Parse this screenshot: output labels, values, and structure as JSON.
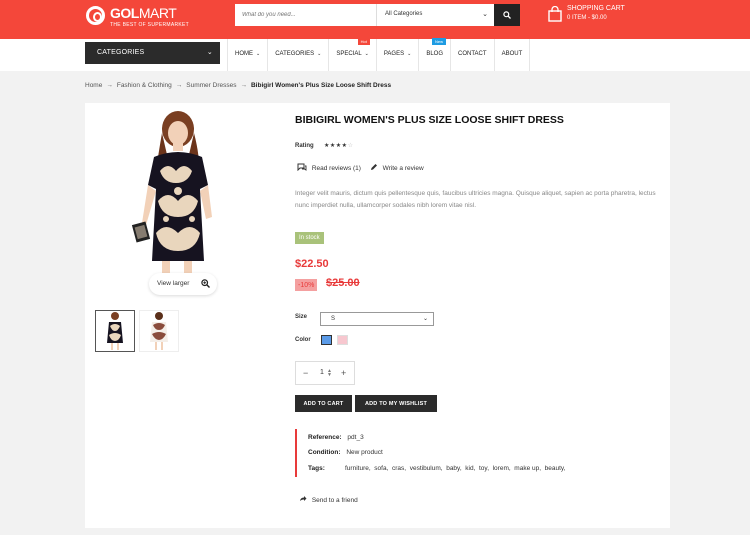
{
  "header": {
    "logo_bold": "GOL",
    "logo_light": "MART",
    "tagline": "THE BEST OF SUPERMARKET",
    "search": {
      "placeholder": "What do you need...",
      "category": "All Categories"
    },
    "cart": {
      "title": "SHOPPING CART",
      "summary": "0 ITEM - $0.00"
    }
  },
  "nav": {
    "categories_label": "CATEGORIES",
    "items": [
      {
        "label": "HOME",
        "dropdown": true
      },
      {
        "label": "CATEGORIES",
        "dropdown": true
      },
      {
        "label": "SPECIAL",
        "dropdown": true,
        "badge": "Hot"
      },
      {
        "label": "PAGES",
        "dropdown": true
      },
      {
        "label": "BLOG",
        "dropdown": false,
        "badge": "New"
      },
      {
        "label": "CONTACT",
        "dropdown": false
      },
      {
        "label": "ABOUT",
        "dropdown": false
      }
    ]
  },
  "breadcrumb": {
    "items": [
      "Home",
      "Fashion & Clothing",
      "Summer Dresses"
    ],
    "current": "Bibigirl Women's Plus Size Loose Shift Dress"
  },
  "gallery": {
    "zoom_label": "View larger"
  },
  "product": {
    "title": "BIBIGIRL WOMEN'S PLUS SIZE LOOSE SHIFT DRESS",
    "rating_label": "Rating",
    "rating": 4,
    "rating_max": 5,
    "read_reviews": "Read reviews (1)",
    "write_review": "Write a review",
    "description": "Integer velit mauris, dictum quis pellentesque quis, faucibus ultricies magna. Quisque aliquet, sapien ac porta pharetra, lectus nunc imperdiet nulla, ullamcorper sodales nibh lorem vitae nisl.",
    "stock": "In stock",
    "price": "$22.50",
    "discount": "-10%",
    "old_price": "$25.00",
    "size_label": "Size",
    "size_value": "S",
    "color_label": "Color",
    "colors": [
      "#5b9be8",
      "#f7c7cf"
    ],
    "quantity": "1",
    "qty_minus": "−",
    "qty_plus": "+",
    "add_to_cart": "ADD TO CART",
    "add_to_wishlist": "ADD TO MY WISHLIST",
    "reference_label": "Reference:",
    "reference": "pdt_3",
    "condition_label": "Condition:",
    "condition": "New product",
    "tags_label": "Tags:",
    "tags": [
      "furniture",
      "sofa",
      "cras",
      "vestibulum",
      "baby",
      "kid",
      "toy",
      "lorem",
      "make up",
      "beauty"
    ],
    "send_to_friend": "Send to a friend"
  }
}
